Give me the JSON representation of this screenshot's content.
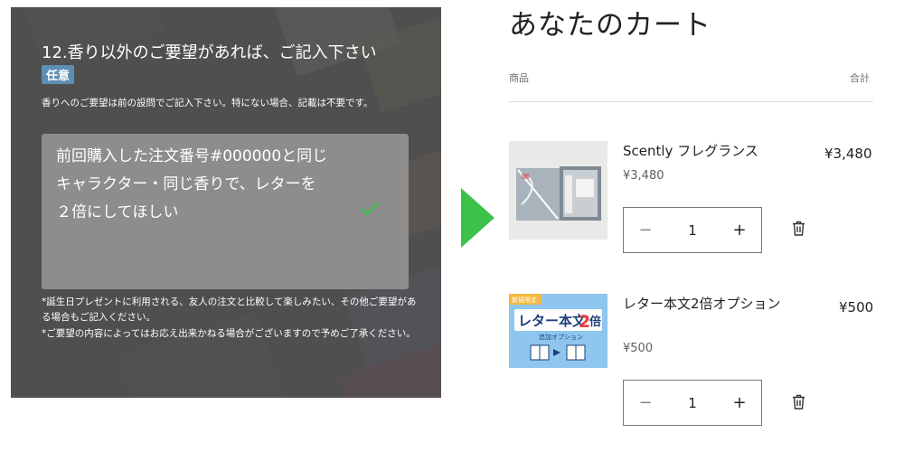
{
  "form": {
    "question_title": "12.香り以外のご要望があれば、ご記入下さい",
    "badge": "任意",
    "help": "香りへのご要望は前の設問でご記入下さい。特にない場合、記載は不要です。",
    "answer_lines": [
      "前回購入した注文番号#000000と同じ",
      "キャラクター・同じ香りで、レターを",
      "２倍にしてほしい"
    ],
    "note1": "*誕生日プレゼントに利用される、友人の注文と比較して楽しみたい、その他ご要望がある場合もご記入ください。",
    "note2": "*ご要望の内容によってはお応え出来かねる場合がございますので予めご了承ください。",
    "check_color": "#3cc24a"
  },
  "arrow_color": "#3cc24a",
  "cart": {
    "title": "あなたのカート",
    "col_product": "商品",
    "col_total": "合計",
    "items": [
      {
        "name": "Scently フレグランス",
        "unit_price": "¥3,480",
        "total": "¥3,480",
        "quantity": "1",
        "minus": "−",
        "plus": "+"
      },
      {
        "name": "レター本文2倍オプション",
        "unit_price": "¥500",
        "total": "¥500",
        "quantity": "1",
        "minus": "−",
        "plus": "+",
        "image_tag": "新規限定",
        "image_title": "レター本文",
        "image_number": "2",
        "image_suffix": "倍",
        "image_subtitle": "追加オプション"
      }
    ]
  }
}
